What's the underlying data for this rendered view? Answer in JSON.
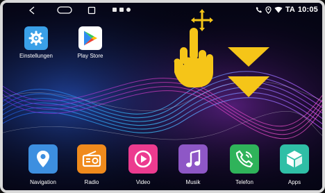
{
  "statusbar": {
    "clock": "10:05",
    "carrier_text": "TA",
    "icons": [
      "back-icon",
      "home-icon",
      "recent-apps-icon",
      "phone-icon",
      "location-icon",
      "wifi-icon"
    ]
  },
  "desktop_apps": [
    {
      "label": "Einstellungen",
      "icon": "gear-icon",
      "color": "#3aa0e8"
    },
    {
      "label": "Play Store",
      "icon": "play-store-icon",
      "color": "#ffffff"
    }
  ],
  "dock_apps": [
    {
      "label": "Navigation",
      "icon": "map-pin-icon",
      "color": "#3d8fe0"
    },
    {
      "label": "Radio",
      "icon": "radio-icon",
      "color": "#f08a1c"
    },
    {
      "label": "Video",
      "icon": "play-circle-icon",
      "color": "#ec3b8f"
    },
    {
      "label": "Musik",
      "icon": "music-note-icon",
      "color": "#8e57c6"
    },
    {
      "label": "Telefon",
      "icon": "phone-icon",
      "color": "#2fb35a"
    },
    {
      "label": "Apps",
      "icon": "cube-icon",
      "color": "#2fbfa6"
    }
  ],
  "gesture": {
    "hand": "pointing-hand-icon",
    "arrows": "double-chevron-down-icon",
    "move": "four-way-arrow-icon",
    "color": "#f5c518"
  }
}
